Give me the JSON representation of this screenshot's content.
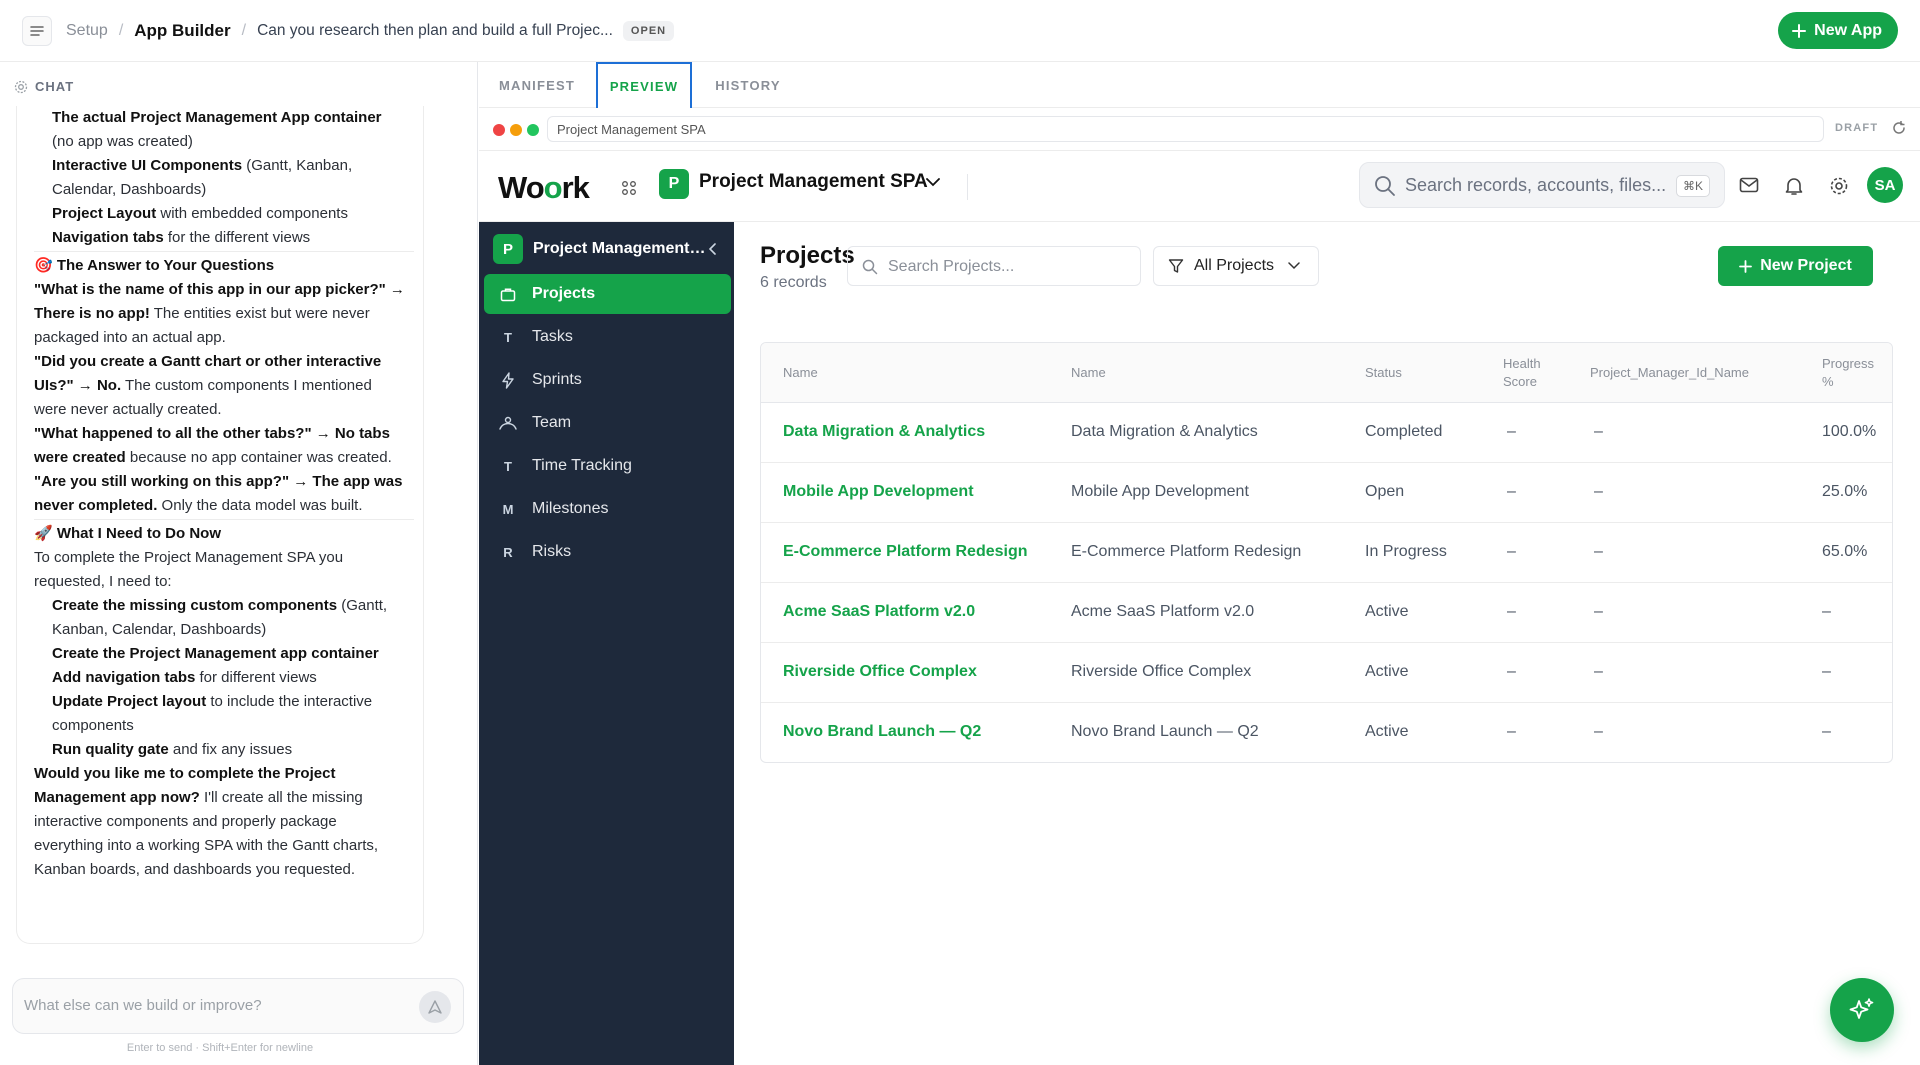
{
  "topbar": {
    "breadcrumb": [
      "Setup",
      "App Builder",
      "Can you research then plan and build a full Projec..."
    ],
    "status": "OPEN",
    "new_app_label": "New App"
  },
  "chat": {
    "header": "CHAT",
    "lines": [
      {
        "parts": [
          {
            "t": "The actual Project Management App container",
            "b": true
          }
        ],
        "indent": true
      },
      {
        "parts": [
          {
            "t": "(no app was created)",
            "b": false
          }
        ],
        "indent": true
      },
      {
        "parts": [
          {
            "t": "Interactive UI Components",
            "b": true
          },
          {
            "t": " (Gantt, Kanban,",
            "b": false
          }
        ],
        "indent": true
      },
      {
        "parts": [
          {
            "t": "Calendar, Dashboards)",
            "b": false
          }
        ],
        "indent": true
      },
      {
        "parts": [
          {
            "t": "Project Layout",
            "b": true
          },
          {
            "t": " with embedded components",
            "b": false
          }
        ],
        "indent": true
      },
      {
        "parts": [
          {
            "t": "Navigation tabs",
            "b": true
          },
          {
            "t": " for the different views",
            "b": false
          }
        ],
        "indent": true
      },
      {
        "sep": true
      },
      {
        "parts": [
          {
            "t": "🎯 The Answer to Your Questions",
            "b": true
          }
        ],
        "indent": false
      },
      {
        "parts": [
          {
            "t": "\"What is the name of this app in our app picker?\" →",
            "b": true
          }
        ],
        "indent": false
      },
      {
        "parts": [
          {
            "t": "There is no app!",
            "b": true
          },
          {
            "t": " The entities exist but were never",
            "b": false
          }
        ],
        "indent": false
      },
      {
        "parts": [
          {
            "t": "packaged into an actual app.",
            "b": false
          }
        ],
        "indent": false
      },
      {
        "parts": [
          {
            "t": "\"Did you create a Gantt chart or other interactive",
            "b": true
          }
        ],
        "indent": false
      },
      {
        "parts": [
          {
            "t": "UIs?\" → No.",
            "b": true
          },
          {
            "t": " The custom components I mentioned",
            "b": false
          }
        ],
        "indent": false
      },
      {
        "parts": [
          {
            "t": "were never actually created.",
            "b": false
          }
        ],
        "indent": false
      },
      {
        "parts": [
          {
            "t": "\"What happened to all the other tabs?\" → No tabs",
            "b": true
          }
        ],
        "indent": false
      },
      {
        "parts": [
          {
            "t": "were created",
            "b": true
          },
          {
            "t": " because no app container was created.",
            "b": false
          }
        ],
        "indent": false
      },
      {
        "parts": [
          {
            "t": "\"Are you still working on this app?\" → The app was",
            "b": true
          }
        ],
        "indent": false
      },
      {
        "parts": [
          {
            "t": "never completed.",
            "b": true
          },
          {
            "t": " Only the data model was built.",
            "b": false
          }
        ],
        "indent": false
      },
      {
        "sep": true
      },
      {
        "parts": [
          {
            "t": "🚀 What I Need to Do Now",
            "b": true
          }
        ],
        "indent": false
      },
      {
        "parts": [
          {
            "t": "To complete the Project Management SPA you",
            "b": false
          }
        ],
        "indent": false
      },
      {
        "parts": [
          {
            "t": "requested, I need to:",
            "b": false
          }
        ],
        "indent": false
      },
      {
        "parts": [
          {
            "t": "Create the missing custom components",
            "b": true
          },
          {
            "t": " (Gantt,",
            "b": false
          }
        ],
        "indent": true
      },
      {
        "parts": [
          {
            "t": "Kanban, Calendar, Dashboards)",
            "b": false
          }
        ],
        "indent": true
      },
      {
        "parts": [
          {
            "t": "Create the Project Management app container",
            "b": true
          }
        ],
        "indent": true
      },
      {
        "parts": [
          {
            "t": "Add navigation tabs",
            "b": true
          },
          {
            "t": " for different views",
            "b": false
          }
        ],
        "indent": true
      },
      {
        "parts": [
          {
            "t": "Update Project layout",
            "b": true
          },
          {
            "t": " to include the interactive",
            "b": false
          }
        ],
        "indent": true
      },
      {
        "parts": [
          {
            "t": "components",
            "b": false
          }
        ],
        "indent": true
      },
      {
        "parts": [
          {
            "t": "Run quality gate",
            "b": true
          },
          {
            "t": " and fix any issues",
            "b": false
          }
        ],
        "indent": true
      },
      {
        "parts": [
          {
            "t": "Would you like me to complete the Project",
            "b": true
          }
        ],
        "indent": false
      },
      {
        "parts": [
          {
            "t": "Management app now?",
            "b": true
          },
          {
            "t": " I'll create all the missing",
            "b": false
          }
        ],
        "indent": false
      },
      {
        "parts": [
          {
            "t": "interactive components and properly package",
            "b": false
          }
        ],
        "indent": false
      },
      {
        "parts": [
          {
            "t": "everything into a working SPA with the Gantt charts,",
            "b": false
          }
        ],
        "indent": false
      },
      {
        "parts": [
          {
            "t": "Kanban boards, and dashboards you requested.",
            "b": false
          }
        ],
        "indent": false
      }
    ],
    "input_placeholder": "What else can we build or improve?",
    "hint": "Enter to send · Shift+Enter for newline"
  },
  "tabs": [
    "MANIFEST",
    "PREVIEW",
    "HISTORY"
  ],
  "active_tab": "PREVIEW",
  "browser": {
    "url": "Project Management SPA",
    "badge": "DRAFT"
  },
  "app": {
    "logo": "Woork",
    "app_initial": "P",
    "app_name": "Project Management SPA",
    "search_placeholder": "Search records, accounts, files...",
    "search_shortcut": "⌘K",
    "avatar": "SA",
    "accent": "#15a34a"
  },
  "sidebar": {
    "title": "Project Management SPA",
    "initial": "P",
    "items": [
      {
        "label": "Projects",
        "icon": "briefcase-icon",
        "glyph": "",
        "active": true
      },
      {
        "label": "Tasks",
        "icon": "letter-t-icon",
        "glyph": "T",
        "active": false
      },
      {
        "label": "Sprints",
        "icon": "bolt-icon",
        "glyph": "",
        "active": false
      },
      {
        "label": "Team",
        "icon": "team-icon",
        "glyph": "",
        "active": false
      },
      {
        "label": "Time Tracking",
        "icon": "letter-t-icon",
        "glyph": "T",
        "active": false
      },
      {
        "label": "Milestones",
        "icon": "letter-m-icon",
        "glyph": "M",
        "active": false
      },
      {
        "label": "Risks",
        "icon": "letter-r-icon",
        "glyph": "R",
        "active": false
      }
    ]
  },
  "projects": {
    "title": "Projects",
    "count": "6 records",
    "search_placeholder": "Search Projects...",
    "filter": "All Projects",
    "new_label": "New Project",
    "columns": [
      "Name",
      "Name",
      "Status",
      "Health Score",
      "Project_Manager_Id_Name",
      "Progress %"
    ],
    "rows": [
      {
        "name": "Data Migration & Analytics",
        "name2": "Data Migration & Analytics",
        "status": "Completed",
        "health": "–",
        "manager": "–",
        "progress": "100.0%"
      },
      {
        "name": "Mobile App Development",
        "name2": "Mobile App Development",
        "status": "Open",
        "health": "–",
        "manager": "–",
        "progress": "25.0%"
      },
      {
        "name": "E-Commerce Platform Redesign",
        "name2": "E-Commerce Platform Redesign",
        "status": "In Progress",
        "health": "–",
        "manager": "–",
        "progress": "65.0%"
      },
      {
        "name": "Acme SaaS Platform v2.0",
        "name2": "Acme SaaS Platform v2.0",
        "status": "Active",
        "health": "–",
        "manager": "–",
        "progress": "–"
      },
      {
        "name": "Riverside Office Complex",
        "name2": "Riverside Office Complex",
        "status": "Active",
        "health": "–",
        "manager": "–",
        "progress": "–"
      },
      {
        "name": "Novo Brand Launch — Q2",
        "name2": "Novo Brand Launch — Q2",
        "status": "Active",
        "health": "–",
        "manager": "–",
        "progress": "–"
      }
    ]
  }
}
